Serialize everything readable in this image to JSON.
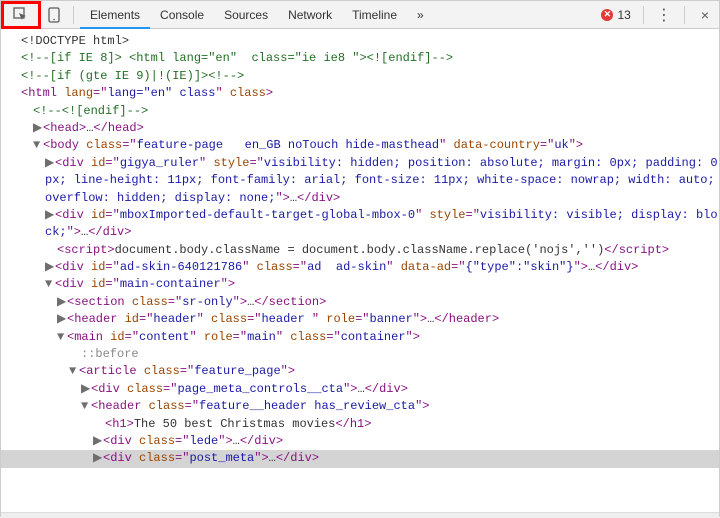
{
  "toolbar": {
    "tabs": [
      "Elements",
      "Console",
      "Sources",
      "Network",
      "Timeline"
    ],
    "more": "»",
    "error_count": "13",
    "close": "×"
  },
  "dom": {
    "doctype": "<!DOCTYPE html>",
    "c1": "<!--[if IE 8]> <html lang=\"en\"  class=\"ie ie8 \"><![endif]-->",
    "c2": "<!--[if (gte IE 9)|!(IE)]><!-->",
    "html_open": {
      "tag": "html",
      "attrs": "lang=\"en\" class"
    },
    "c3": "<!--<![endif]-->",
    "head": {
      "open": "<head>",
      "ellipsis": "…",
      "close": "</head>"
    },
    "body_open": {
      "tag": "body",
      "class": "feature-page   en_GB noTouch hide-masthead",
      "data_country": "uk"
    },
    "gigya": {
      "id": "gigya_ruler",
      "style": "visibility: hidden; position: absolute; margin: 0px; padding: 0px; line-height: 11px; font-family: arial; font-size: 11px; white-space: nowrap; width: auto; overflow: hidden; display: none;"
    },
    "mbox": {
      "id": "mboxImported-default-target-global-mbox-0",
      "style": "visibility: visible; display: block;"
    },
    "script_text": "document.body.className = document.body.className.replace('nojs','')",
    "adskin": {
      "id": "ad-skin-640121786",
      "class": "ad  ad-skin",
      "data_ad": "{\"type\":\"skin\"}"
    },
    "main_container": "main-container",
    "section_class": "sr-only",
    "header": {
      "id": "header",
      "class": "header ",
      "role": "banner"
    },
    "main": {
      "id": "content",
      "role": "main",
      "class": "container"
    },
    "pseudo_before": "::before",
    "article_class": "feature_page",
    "page_meta": "page_meta_controls__cta",
    "feature_header": "feature__header has_review_cta",
    "h1_text": "The 50 best Christmas movies",
    "lede": "lede",
    "post_meta": "post_meta"
  }
}
